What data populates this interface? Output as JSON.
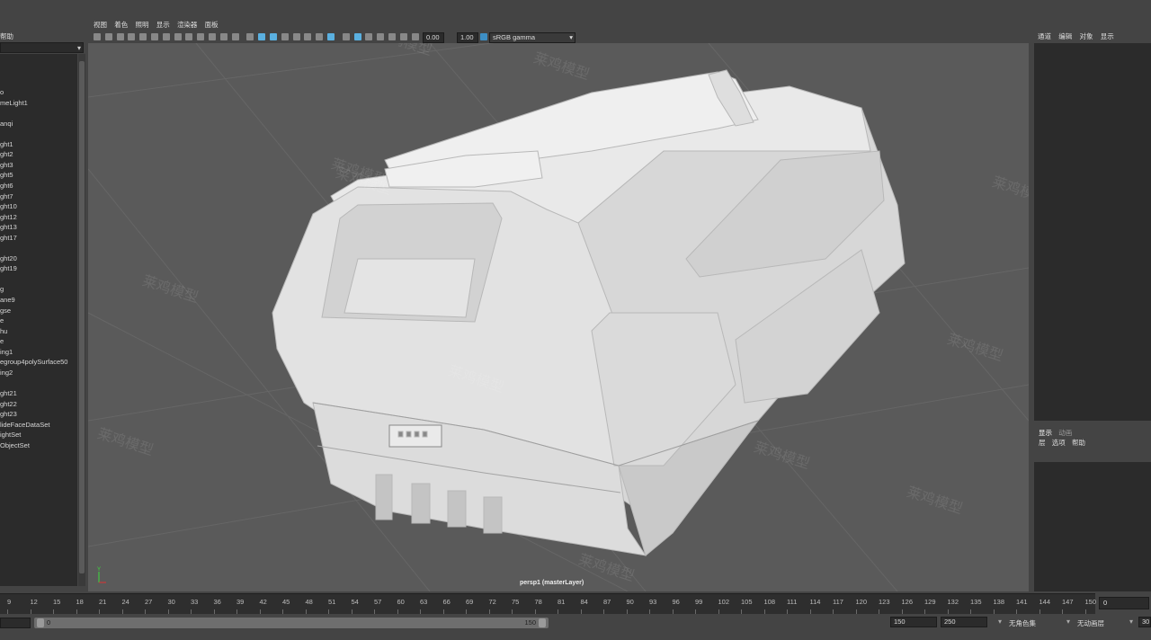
{
  "outliner": {
    "menu_help": "帮助",
    "items": [
      "o",
      "meLight1",
      "",
      "anqi",
      "",
      "ght1",
      "ght2",
      "ght3",
      "ght5",
      "ght6",
      "ght7",
      "ght10",
      "ght12",
      "ght13",
      "ght17",
      "",
      "ght20",
      "ght19",
      "",
      "g",
      "ane9",
      "gse",
      "e",
      "hu",
      "e",
      "ing1",
      "egroup4polySurface50",
      "ing2",
      "",
      "ght21",
      "ght22",
      "ght23",
      "lideFaceDataSet",
      "ightSet",
      "ObjectSet"
    ]
  },
  "viewport": {
    "menus": [
      "视图",
      "着色",
      "照明",
      "显示",
      "渲染器",
      "面板"
    ],
    "exposure": "0.00",
    "gamma": "1.00",
    "color_space": "sRGB gamma",
    "camera_label": "persp1 (masterLayer)",
    "watermark": "莱鸡模型",
    "colors": {
      "background": "#5a5a5a",
      "model": "#e6e6e6"
    }
  },
  "channel_box": {
    "menus": [
      "通道",
      "编辑",
      "对象",
      "显示"
    ]
  },
  "layer_editor": {
    "tabs": [
      "显示",
      "动画"
    ],
    "menus": [
      "层",
      "选项",
      "帮助"
    ]
  },
  "timeline": {
    "ticks": [
      "9",
      "12",
      "15",
      "18",
      "21",
      "24",
      "27",
      "30",
      "33",
      "36",
      "39",
      "42",
      "45",
      "48",
      "51",
      "54",
      "57",
      "60",
      "63",
      "66",
      "69",
      "72",
      "75",
      "78",
      "81",
      "84",
      "87",
      "90",
      "93",
      "96",
      "99",
      "102",
      "105",
      "108",
      "111",
      "114",
      "117",
      "120",
      "123",
      "126",
      "129",
      "132",
      "135",
      "138",
      "141",
      "144",
      "147",
      "150"
    ],
    "current_frame": "0"
  },
  "range": {
    "start": "0",
    "end": "150",
    "anim_end": "150",
    "max_end": "250",
    "character_set": "无角色集",
    "anim_layer": "无动画层",
    "fps": "30"
  }
}
